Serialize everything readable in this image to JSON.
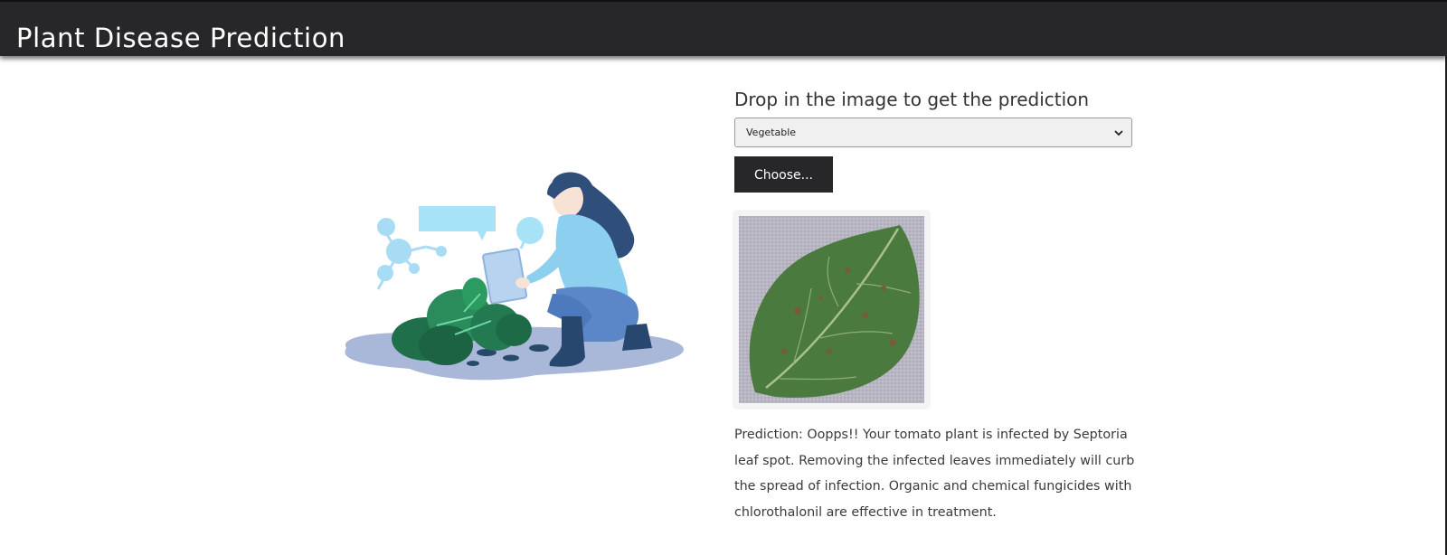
{
  "navbar": {
    "brand": "Plant Disease Prediction"
  },
  "illustration": {
    "icon": "woman-inspecting-plant-illustration"
  },
  "upload": {
    "title": "Drop in the image to get the prediction",
    "category_select": {
      "selected": "Vegetable",
      "icon": "chevron-down-icon"
    },
    "choose_label": "Choose..."
  },
  "preview": {
    "icon": "leaf-image"
  },
  "result": {
    "prediction_text": "Prediction: Oopps!! Your tomato plant is infected by Septoria leaf spot. Removing the infected leaves immediately will curb the spread of infection. Organic and chemical fungicides with chlorothalonil are effective in treatment."
  },
  "colors": {
    "navbar_bg": "#27272a",
    "button_bg": "#27272a",
    "text": "#3a3a3a"
  }
}
